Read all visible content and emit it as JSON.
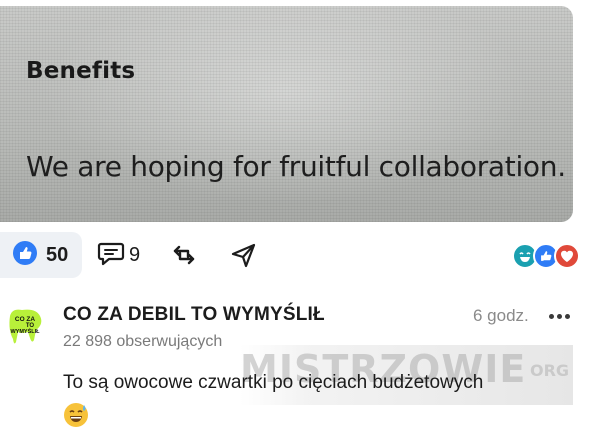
{
  "image": {
    "heading": "Benefits",
    "text": "We are hoping for fruitful collaboration."
  },
  "actions": {
    "like_count": "50",
    "comment_count": "9",
    "like_icon": "thumbs-up-icon",
    "comment_icon": "comment-bubble-icon",
    "repost_icon": "repost-arrows-icon",
    "share_icon": "send-arrow-icon",
    "reactions": [
      "laughing-emoji-icon",
      "thumbs-up-icon",
      "heart-icon"
    ]
  },
  "post": {
    "author": "CO ZA DEBIL TO WYMYŚLIŁ",
    "avatar_text": "CO ZA TO WYMYŚLIŁ",
    "followers": "22 898 obserwujących",
    "time": "6 godz.",
    "text": "To są owocowe czwartki po cięciach budżetowych",
    "emoji": "sweat-smile-emoji-icon"
  },
  "watermark": {
    "text": "MISTRZOWIE",
    "sub": "ORG"
  },
  "colors": {
    "like_blue": "#2f7cf6",
    "like_bg": "#eef1f5",
    "heart_red": "#e0493a",
    "laugh_teal": "#1aa0b0",
    "avatar_green": "#b8f03a",
    "muted_text": "#7a7a7a"
  }
}
